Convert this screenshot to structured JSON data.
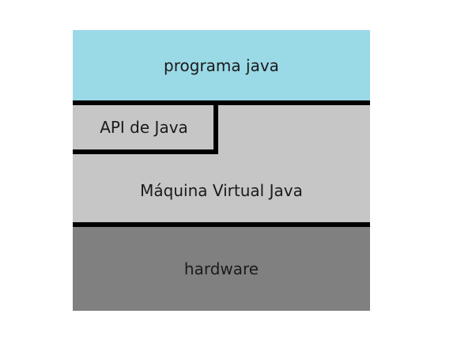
{
  "diagram": {
    "layers": [
      {
        "id": "program",
        "label": "programa java",
        "color": "#9ad9e6"
      },
      {
        "id": "api",
        "label": "API de Java",
        "color": "#c6c6c6"
      },
      {
        "id": "jvm",
        "label": "Máquina Virtual Java",
        "color": "#c6c6c6"
      },
      {
        "id": "hardware",
        "label": "hardware",
        "color": "#808080"
      }
    ],
    "border_color": "#000000"
  }
}
